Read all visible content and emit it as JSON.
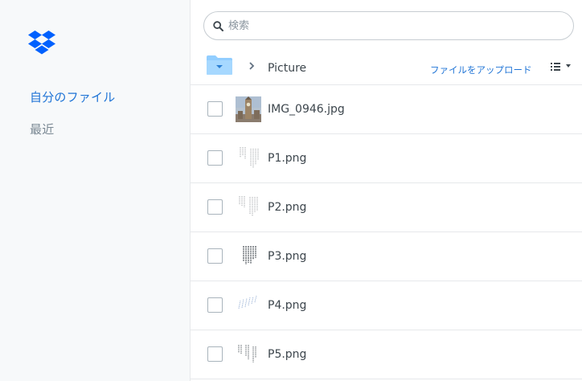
{
  "app": {
    "accent_color": "#1f74d6",
    "logo": "dropbox-logo"
  },
  "sidebar": {
    "items": [
      {
        "label": "自分のファイル",
        "active": true
      },
      {
        "label": "最近",
        "active": false
      }
    ]
  },
  "search": {
    "placeholder": "検索",
    "value": ""
  },
  "header": {
    "breadcrumb": "Picture",
    "upload_label": "ファイルをアップロード",
    "view_icon": "list-view-icon"
  },
  "files": [
    {
      "name": "IMG_0946.jpg",
      "thumb": "photo"
    },
    {
      "name": "P1.png",
      "thumb": "text-vertical"
    },
    {
      "name": "P2.png",
      "thumb": "text-vertical"
    },
    {
      "name": "P3.png",
      "thumb": "text-bold"
    },
    {
      "name": "P4.png",
      "thumb": "text-diagonal"
    },
    {
      "name": "P5.png",
      "thumb": "text-columns"
    }
  ]
}
